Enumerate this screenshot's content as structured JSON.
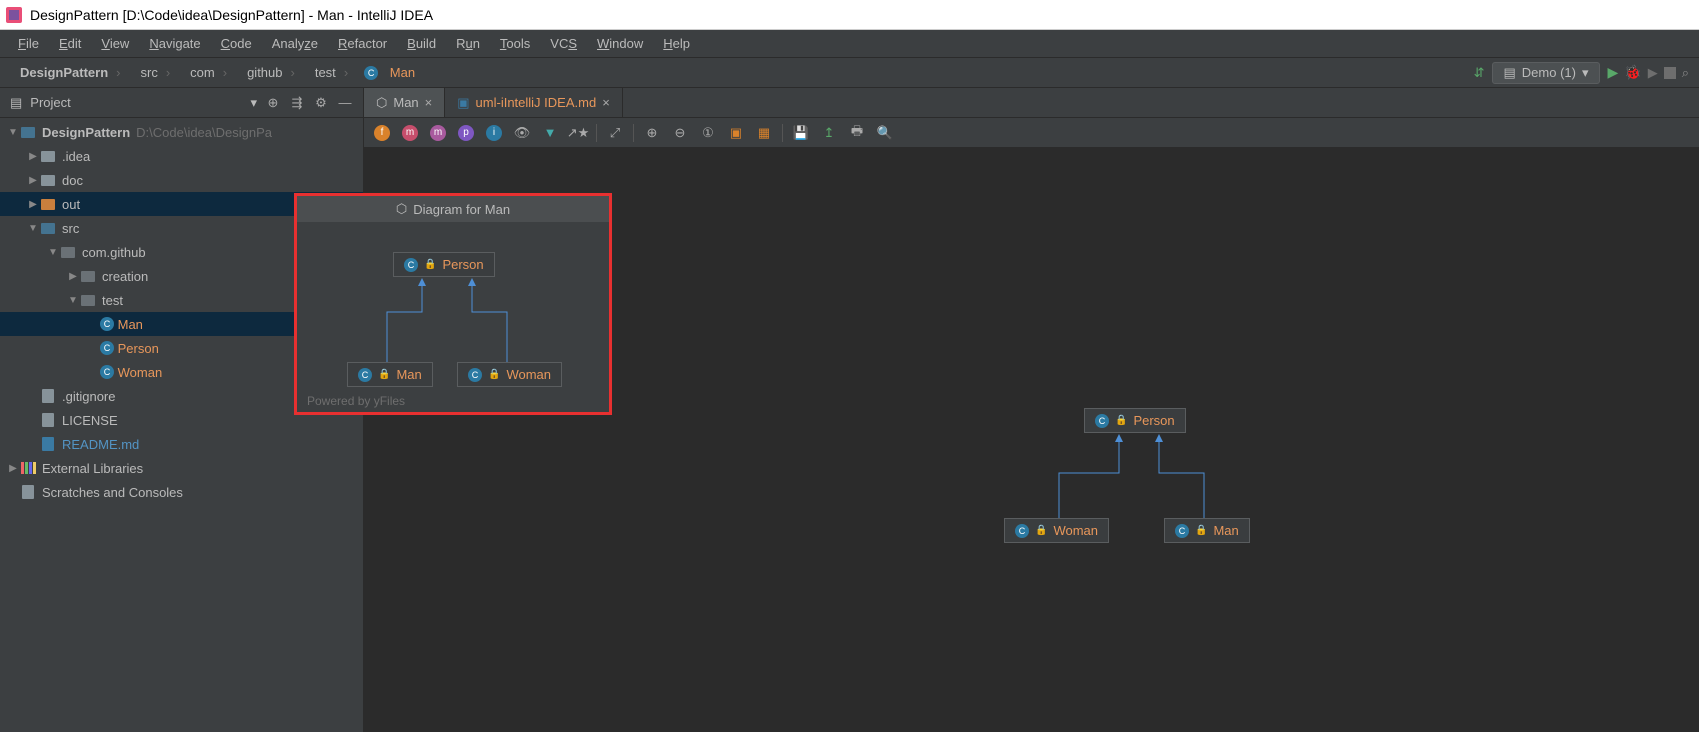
{
  "window_title": "DesignPattern [D:\\Code\\idea\\DesignPattern] - Man - IntelliJ IDEA",
  "menu": [
    "File",
    "Edit",
    "View",
    "Navigate",
    "Code",
    "Analyze",
    "Refactor",
    "Build",
    "Run",
    "Tools",
    "VCS",
    "Window",
    "Help"
  ],
  "breadcrumbs": [
    {
      "icon": "folder",
      "label": "DesignPattern"
    },
    {
      "icon": "folder",
      "label": "src"
    },
    {
      "icon": "folder",
      "label": "com"
    },
    {
      "icon": "folder",
      "label": "github"
    },
    {
      "icon": "folder",
      "label": "test"
    },
    {
      "icon": "class",
      "label": "Man",
      "active": true
    }
  ],
  "run_config": "Demo (1)",
  "sidebar": {
    "title": "Project"
  },
  "tree": {
    "root": {
      "label": "DesignPattern",
      "hint": "D:\\Code\\idea\\DesignPa"
    },
    "idea": ".idea",
    "doc": "doc",
    "out": "out",
    "src": "src",
    "pkg": "com.github",
    "creation": "creation",
    "test": "test",
    "man": "Man",
    "person": "Person",
    "woman": "Woman",
    "gitignore": ".gitignore",
    "license": "LICENSE",
    "readme": "README.md",
    "extlib": "External Libraries",
    "scratches": "Scratches and Consoles"
  },
  "tabs": [
    {
      "icon": "uml",
      "label": "Man",
      "active": true
    },
    {
      "icon": "md",
      "label": "uml-iIntelliJ IDEA.md"
    }
  ],
  "diagram_popup": {
    "title": "Diagram for Man",
    "nodes": {
      "parent": "Person",
      "left": "Man",
      "right": "Woman"
    },
    "powered": "Powered by yFiles"
  },
  "diagram_main": {
    "nodes": {
      "parent": "Person",
      "left": "Woman",
      "right": "Man"
    }
  }
}
